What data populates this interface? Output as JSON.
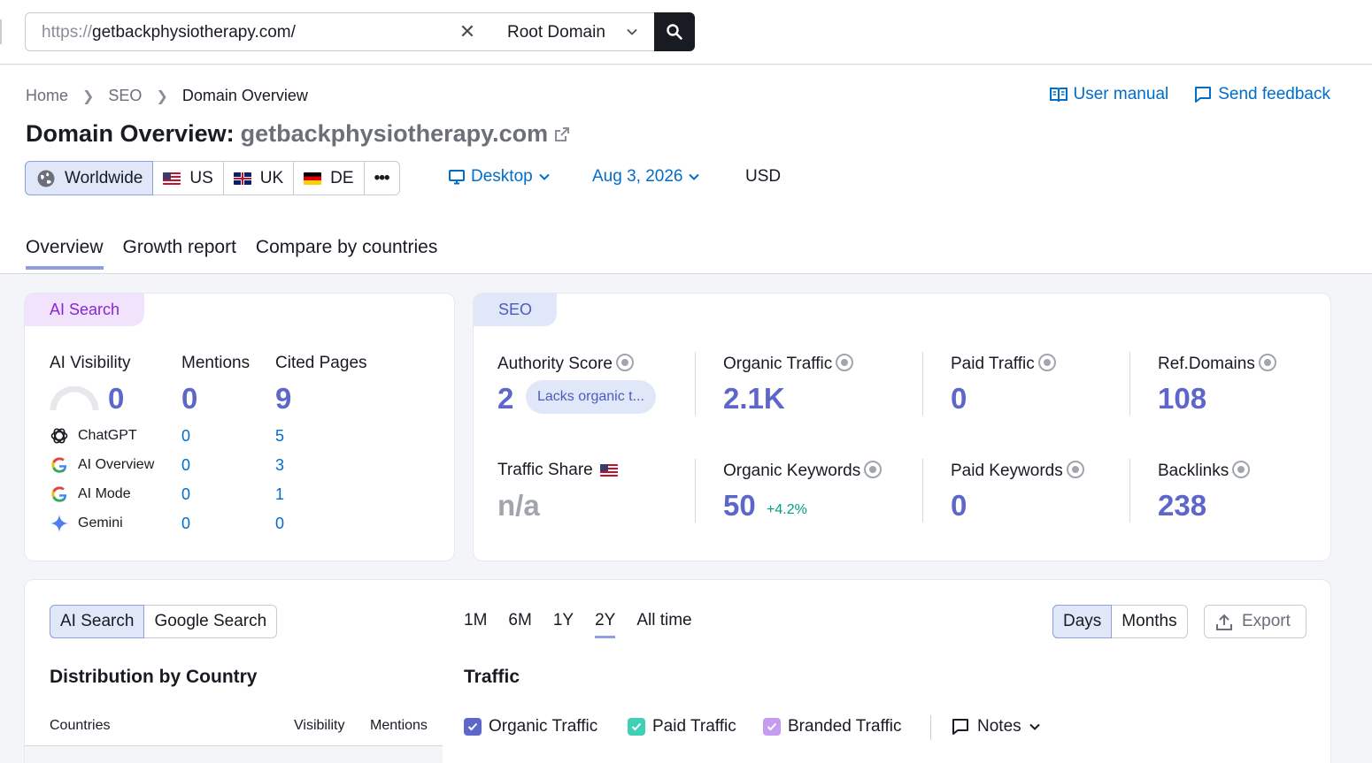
{
  "search": {
    "url_proto": "https://",
    "url_domain": "getbackphysiotherapy.com/",
    "scope_label": "Root Domain"
  },
  "breadcrumb": {
    "home": "Home",
    "seo": "SEO",
    "current": "Domain Overview"
  },
  "header_links": {
    "user_manual": "User manual",
    "send_feedback": "Send feedback"
  },
  "title": {
    "prefix": "Domain Overview:",
    "domain": "getbackphysiotherapy.com"
  },
  "regions": [
    {
      "label": "Worldwide"
    },
    {
      "label": "US"
    },
    {
      "label": "UK"
    },
    {
      "label": "DE"
    }
  ],
  "regions_more": "•••",
  "filters": {
    "device": "Desktop",
    "date": "Aug 3, 2026",
    "currency": "USD"
  },
  "tabs": [
    "Overview",
    "Growth report",
    "Compare by countries"
  ],
  "ai_card": {
    "badge": "AI Search",
    "visibility_label": "AI Visibility",
    "visibility_value": "0",
    "mentions_label": "Mentions",
    "mentions_value": "0",
    "cited_label": "Cited Pages",
    "cited_value": "9",
    "platforms": [
      {
        "name": "ChatGPT",
        "mentions": "0",
        "cited": "5"
      },
      {
        "name": "AI Overview",
        "mentions": "0",
        "cited": "3"
      },
      {
        "name": "AI Mode",
        "mentions": "0",
        "cited": "1"
      },
      {
        "name": "Gemini",
        "mentions": "0",
        "cited": "0"
      }
    ]
  },
  "seo_card": {
    "badge": "SEO",
    "authority_label": "Authority Score",
    "authority_value": "2",
    "authority_pill": "Lacks organic t...",
    "organic_traffic_label": "Organic Traffic",
    "organic_traffic_value": "2.1K",
    "paid_traffic_label": "Paid Traffic",
    "paid_traffic_value": "0",
    "ref_domains_label": "Ref.Domains",
    "ref_domains_value": "108",
    "traffic_share_label": "Traffic Share",
    "traffic_share_value": "n/a",
    "organic_keywords_label": "Organic Keywords",
    "organic_keywords_value": "50",
    "organic_keywords_change": "+4.2%",
    "paid_keywords_label": "Paid Keywords",
    "paid_keywords_value": "0",
    "backlinks_label": "Backlinks",
    "backlinks_value": "238"
  },
  "bottom": {
    "source_toggle": [
      "AI Search",
      "Google Search"
    ],
    "periods": [
      "1M",
      "6M",
      "1Y",
      "2Y",
      "All time"
    ],
    "granularity": [
      "Days",
      "Months"
    ],
    "export_label": "Export",
    "distribution_title": "Distribution by Country",
    "traffic_title": "Traffic",
    "columns": {
      "countries": "Countries",
      "visibility": "Visibility",
      "mentions": "Mentions"
    },
    "legend": {
      "organic": "Organic Traffic",
      "paid": "Paid Traffic",
      "branded": "Branded Traffic",
      "notes": "Notes"
    }
  },
  "colors": {
    "accent_blue": "#006dca",
    "metric_purple": "#5d67c9",
    "organic_check": "#5d67c9",
    "paid_check": "#3fd0b6",
    "branded_check": "#c69bf2",
    "positive_green": "#009f81"
  }
}
